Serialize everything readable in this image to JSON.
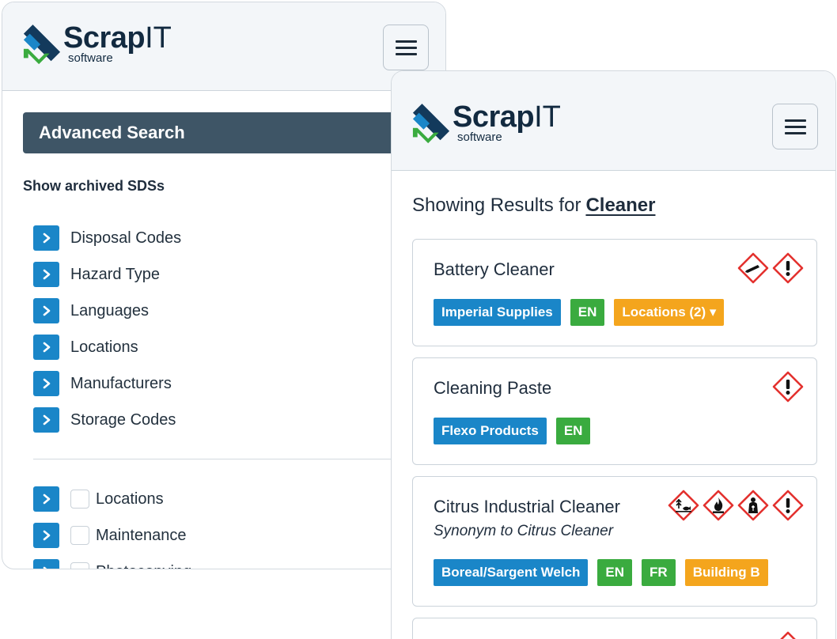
{
  "brand": {
    "name_bold": "Scrap",
    "name_regular": "IT",
    "tagline": "software",
    "colors": {
      "dark": "#122a40",
      "blue": "#1a86c8",
      "green": "#3aab3f"
    }
  },
  "left_panel": {
    "advanced_search_title": "Advanced Search",
    "show_archived_label": "Show archived SDSs",
    "filters": [
      {
        "label": "Disposal Codes"
      },
      {
        "label": "Hazard Type"
      },
      {
        "label": "Languages"
      },
      {
        "label": "Locations"
      },
      {
        "label": "Manufacturers"
      },
      {
        "label": "Storage Codes"
      }
    ],
    "checkbox_filters": [
      {
        "label": "Locations",
        "checked": false
      },
      {
        "label": "Maintenance",
        "checked": false
      },
      {
        "label": "Photocopying",
        "checked": false
      }
    ]
  },
  "right_panel": {
    "results_prefix": "Showing Results for",
    "search_term": "Cleaner",
    "results": [
      {
        "title": "Battery Cleaner",
        "synonym": "",
        "pictograms": [
          "corrosion-icon",
          "exclamation-icon"
        ],
        "tags": [
          {
            "label": "Imperial Supplies",
            "color": "#1a86c8"
          },
          {
            "label": "EN",
            "color": "#3aab3f"
          },
          {
            "label": "Locations (2) ▾",
            "color": "#f4a51d"
          }
        ]
      },
      {
        "title": "Cleaning Paste",
        "synonym": "",
        "pictograms": [
          "exclamation-icon"
        ],
        "tags": [
          {
            "label": "Flexo Products",
            "color": "#1a86c8"
          },
          {
            "label": "EN",
            "color": "#3aab3f"
          }
        ]
      },
      {
        "title": "Citrus Industrial Cleaner",
        "synonym": "Synonym to Citrus Cleaner",
        "pictograms": [
          "environment-icon",
          "flame-icon",
          "health-hazard-icon",
          "exclamation-icon"
        ],
        "tags": [
          {
            "label": "Boreal/Sargent Welch",
            "color": "#1a86c8"
          },
          {
            "label": "EN",
            "color": "#3aab3f"
          },
          {
            "label": "FR",
            "color": "#3aab3f"
          },
          {
            "label": "Building B",
            "color": "#f4a51d"
          }
        ]
      }
    ]
  }
}
